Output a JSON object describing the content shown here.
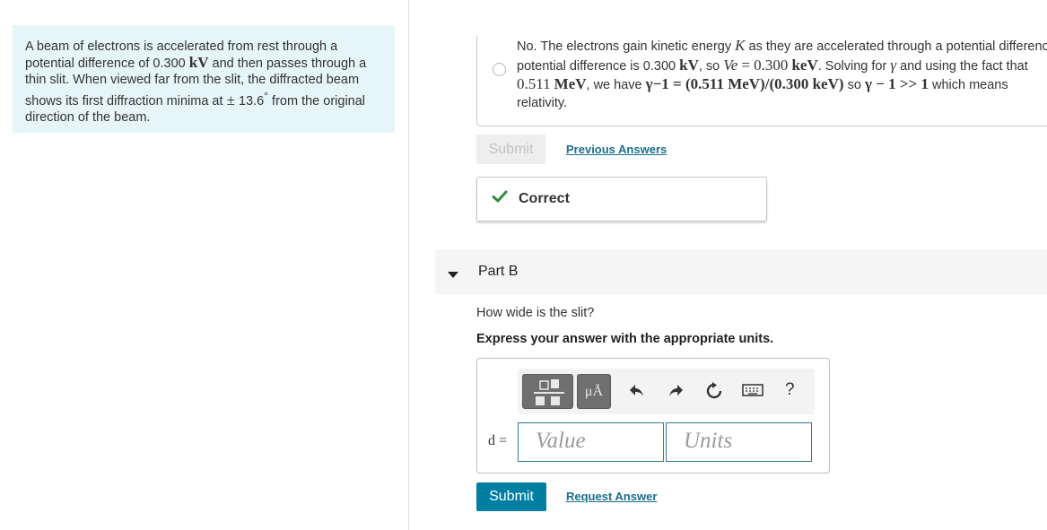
{
  "problem": {
    "t1": "A beam of electrons is accelerated from rest through a potential difference of 0.300",
    "unit_kv": "kV",
    "t2": "and then passes through a thin slit. When viewed far from the slit, the diffracted beam shows its first diffraction minima at",
    "pm": "±",
    "angle": "13.6",
    "degree": "°",
    "t3": "from the original direction of the beam."
  },
  "part_a": {
    "choice": {
      "line1_a": "No. The electrons gain kinetic energy",
      "K": "K",
      "line1_b": "as they are accelerated through a potential difference",
      "line2_a": "potential difference is 0.300",
      "kV": "kV",
      "line2_b": ", so",
      "Ve": "Ve",
      "eq": "= 0.300",
      "keV": "keV",
      "line2_c": ". Solving for",
      "gamma": "γ",
      "line2_d": "and using the fact that",
      "line3_a": "0.511",
      "MeV": "MeV",
      "line3_b": ", we have",
      "gexpr": "γ−1 = (0.511 MeV)/(0.300 keV)",
      "line3_c": "so",
      "gexpr2": "γ − 1 >> 1",
      "line3_d": "which means",
      "line4": "relativity."
    },
    "submit_label": "Submit",
    "previous_answers_label": "Previous Answers",
    "feedback_label": "Correct"
  },
  "part_b": {
    "title": "Part B",
    "question": "How wide is the slit?",
    "instruction": "Express your answer with the appropriate units.",
    "toolbar": {
      "templates_icon": "fraction-template-icon",
      "units_label": "μÅ",
      "undo_icon": "undo-icon",
      "redo_icon": "redo-icon",
      "reset_icon": "reset-icon",
      "keyboard_icon": "keyboard-icon",
      "help_label": "?"
    },
    "variable_label": "d =",
    "value_placeholder": "Value",
    "units_placeholder": "Units",
    "submit_label": "Submit",
    "request_answer_label": "Request Answer"
  },
  "colors": {
    "problem_bg": "#e6f5f7",
    "link": "#1a6e8e",
    "submit": "#007fa3",
    "correct_check": "#2e8b3c"
  }
}
